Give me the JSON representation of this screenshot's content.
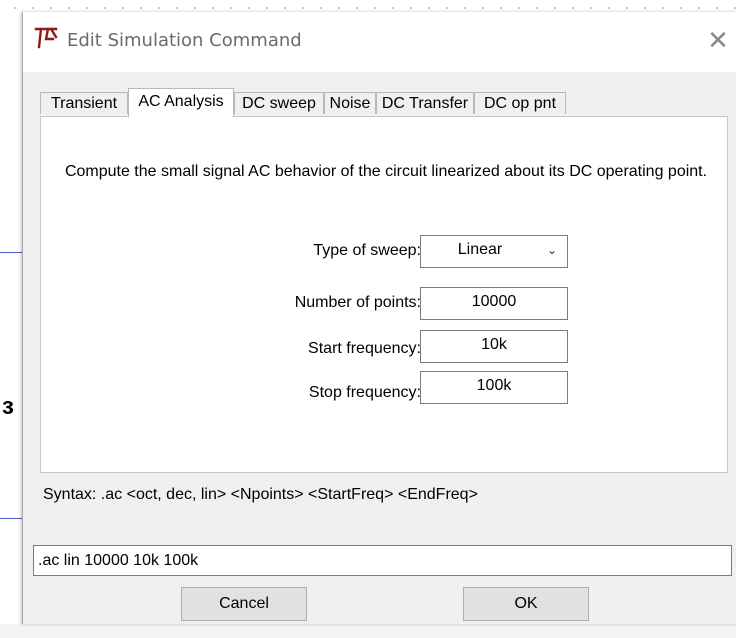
{
  "dialog": {
    "title": "Edit Simulation Command",
    "close_glyph": "✕"
  },
  "tabs": [
    {
      "label": "Transient",
      "active": false
    },
    {
      "label": "AC Analysis",
      "active": true
    },
    {
      "label": "DC sweep",
      "active": false
    },
    {
      "label": "Noise",
      "active": false
    },
    {
      "label": "DC Transfer",
      "active": false
    },
    {
      "label": "DC op pnt",
      "active": false
    }
  ],
  "ac_panel": {
    "description": "Compute the small signal AC behavior of the circuit linearized about its DC operating point.",
    "type_of_sweep": {
      "label": "Type of sweep:",
      "value": "Linear"
    },
    "number_of_points": {
      "label": "Number of points:",
      "value": "10000"
    },
    "start_frequency": {
      "label": "Start frequency:",
      "value": "10k"
    },
    "stop_frequency": {
      "label": "Stop frequency:",
      "value": "100k"
    }
  },
  "syntax_text": "Syntax:  .ac <oct, dec, lin> <Npoints> <StartFreq> <EndFreq>",
  "command_line": ".ac lin 10000 10k 100k",
  "buttons": {
    "cancel": "Cancel",
    "ok": "OK"
  },
  "icons": {
    "app": "ltspice-logo-icon",
    "close": "close-icon",
    "dropdown": "chevron-down-icon"
  },
  "colors": {
    "icon_red": "#8b1a1a",
    "wire_blue": "#4a5fc1"
  }
}
